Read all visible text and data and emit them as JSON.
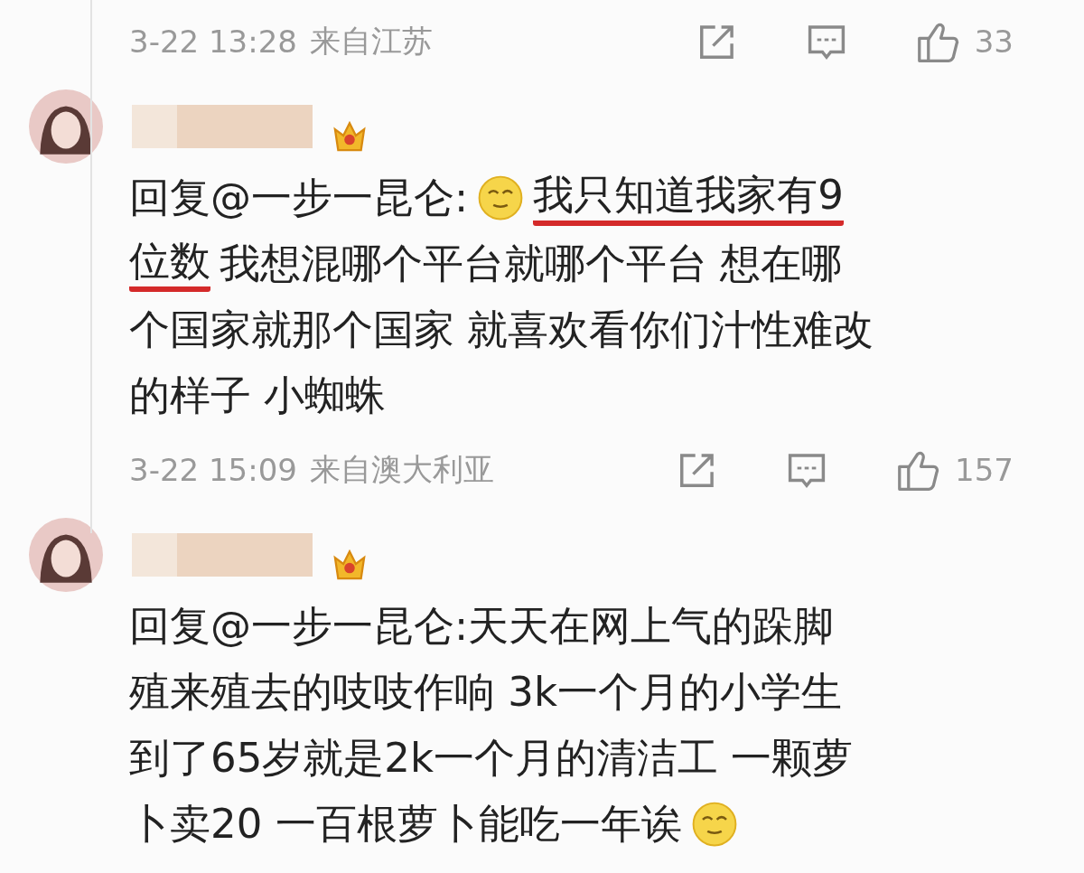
{
  "top_meta": {
    "time": "3-22 13:28",
    "location": "来自江苏",
    "likes": "33"
  },
  "comments": [
    {
      "lines": [
        [
          {
            "kind": "text",
            "text": "回复@一步一昆仑:"
          },
          {
            "kind": "emoji"
          },
          {
            "kind": "underlined",
            "text": "我只知道我家有9"
          }
        ],
        [
          {
            "kind": "underlined",
            "text": "位数"
          },
          {
            "kind": "text",
            "text": "我想混哪个平台就哪个平台 想在哪"
          }
        ],
        [
          {
            "kind": "text",
            "text": "个国家就那个国家 就喜欢看你们汁性难改"
          }
        ],
        [
          {
            "kind": "text",
            "text": "的样子 小蜘蛛"
          }
        ]
      ],
      "meta": {
        "time": "3-22 15:09",
        "location": "来自澳大利亚",
        "likes": "157"
      }
    },
    {
      "lines": [
        [
          {
            "kind": "text",
            "text": "回复@一步一昆仑:天天在网上气的跺脚"
          }
        ],
        [
          {
            "kind": "text",
            "text": "殖来殖去的吱吱作响 3k一个月的小学生"
          }
        ],
        [
          {
            "kind": "text",
            "text": "到了65岁就是2k一个月的清洁工 一颗萝"
          }
        ],
        [
          {
            "kind": "text",
            "text": "卜卖20 一百根萝卜能吃一年诶"
          },
          {
            "kind": "emoji"
          }
        ]
      ]
    }
  ]
}
